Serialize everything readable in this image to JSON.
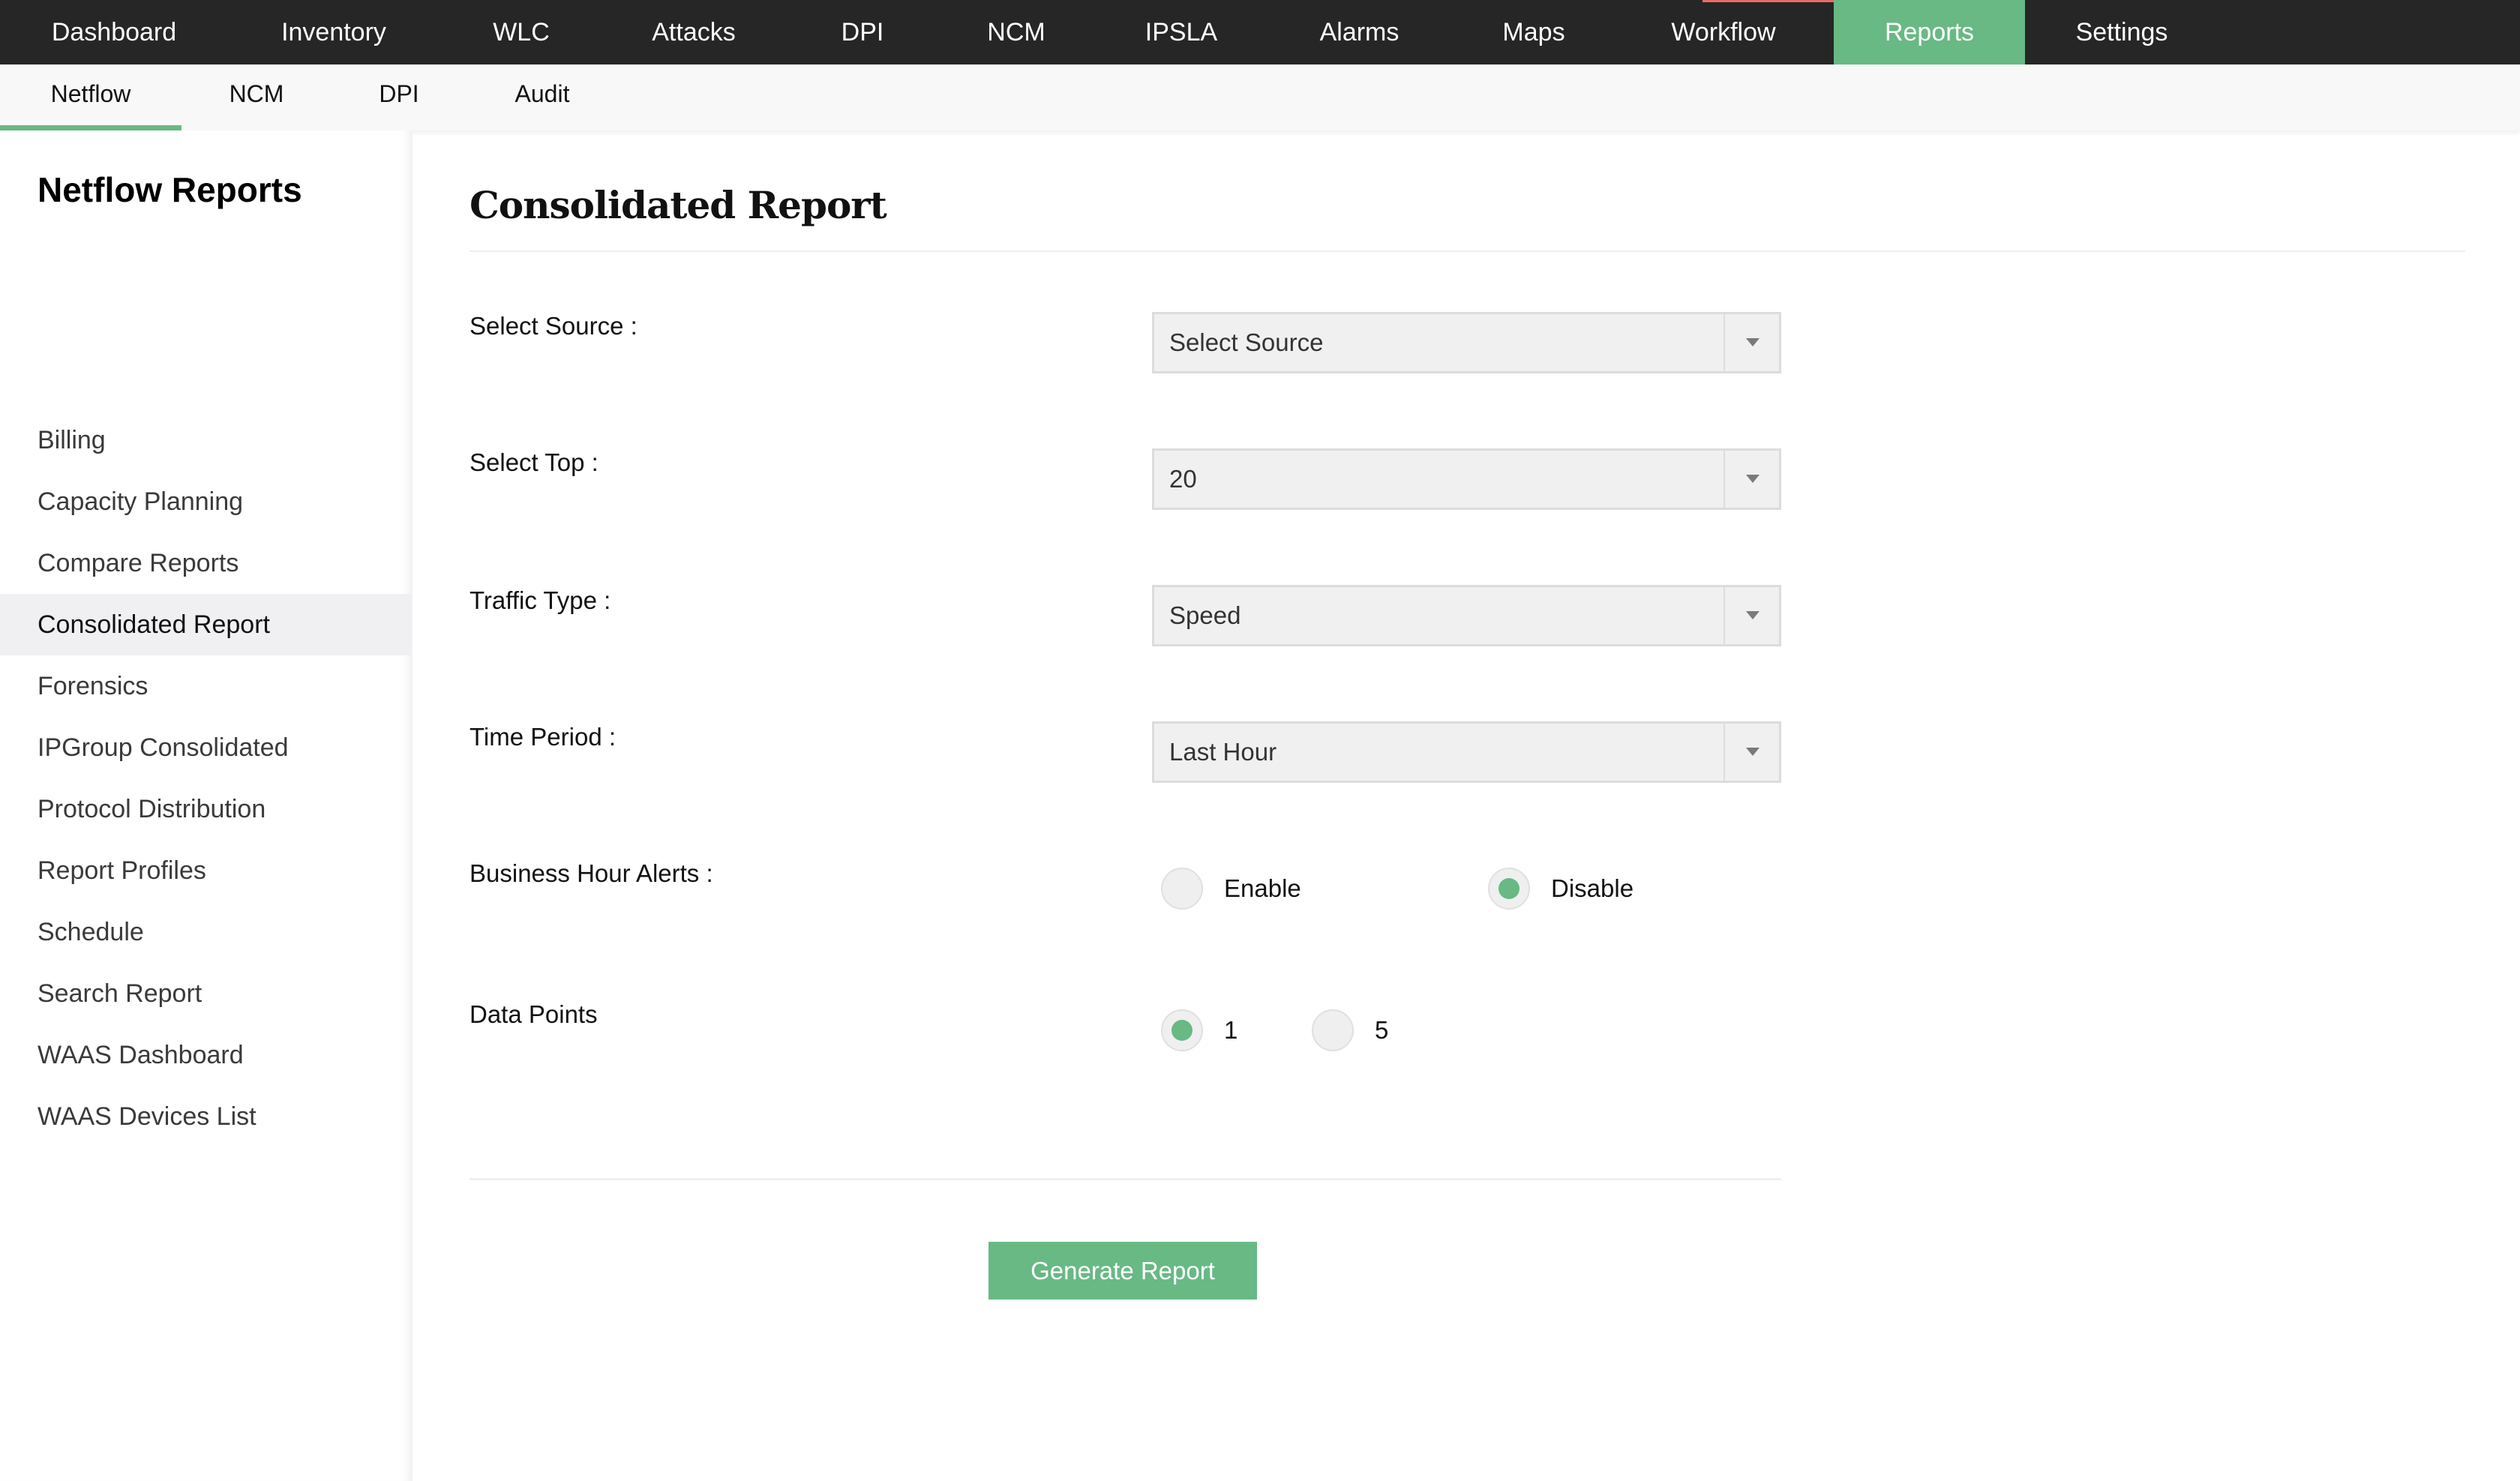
{
  "topnav": {
    "items": [
      {
        "label": "Dashboard",
        "active": false
      },
      {
        "label": "Inventory",
        "active": false
      },
      {
        "label": "WLC",
        "active": false
      },
      {
        "label": "Attacks",
        "active": false
      },
      {
        "label": "DPI",
        "active": false
      },
      {
        "label": "NCM",
        "active": false
      },
      {
        "label": "IPSLA",
        "active": false
      },
      {
        "label": "Alarms",
        "active": false
      },
      {
        "label": "Maps",
        "active": false
      },
      {
        "label": "Workflow",
        "active": false
      },
      {
        "label": "Reports",
        "active": true
      },
      {
        "label": "Settings",
        "active": false
      }
    ]
  },
  "subnav": {
    "items": [
      {
        "label": "Netflow",
        "active": true
      },
      {
        "label": "NCM",
        "active": false
      },
      {
        "label": "DPI",
        "active": false
      },
      {
        "label": "Audit",
        "active": false
      }
    ]
  },
  "sidebar": {
    "title": "Netflow Reports",
    "items": [
      {
        "label": "Billing",
        "active": false
      },
      {
        "label": "Capacity Planning",
        "active": false
      },
      {
        "label": "Compare Reports",
        "active": false
      },
      {
        "label": "Consolidated Report",
        "active": true
      },
      {
        "label": "Forensics",
        "active": false
      },
      {
        "label": "IPGroup Consolidated",
        "active": false
      },
      {
        "label": "Protocol Distribution",
        "active": false
      },
      {
        "label": "Report Profiles",
        "active": false
      },
      {
        "label": "Schedule",
        "active": false
      },
      {
        "label": "Search Report",
        "active": false
      },
      {
        "label": "WAAS Dashboard",
        "active": false
      },
      {
        "label": "WAAS Devices List",
        "active": false
      }
    ]
  },
  "main": {
    "title": "Consolidated Report",
    "fields": {
      "source": {
        "label": "Select Source :",
        "value": "Select Source"
      },
      "top": {
        "label": "Select Top :",
        "value": "20"
      },
      "traffic_type": {
        "label": "Traffic Type :",
        "value": "Speed"
      },
      "time_period": {
        "label": "Time Period :",
        "value": "Last Hour"
      }
    },
    "business_hour_alerts": {
      "label": "Business Hour Alerts :",
      "options": [
        {
          "label": "Enable",
          "checked": false
        },
        {
          "label": "Disable",
          "checked": true
        }
      ]
    },
    "data_points": {
      "label": "Data Points",
      "options": [
        {
          "label": "1",
          "checked": true
        },
        {
          "label": "5",
          "checked": false
        }
      ]
    },
    "generate_button": "Generate Report"
  },
  "colors": {
    "accent": "#68b984",
    "topnav_bg": "#262626",
    "subnav_bg": "#f8f8f8",
    "select_bg": "#f0f0f0"
  }
}
